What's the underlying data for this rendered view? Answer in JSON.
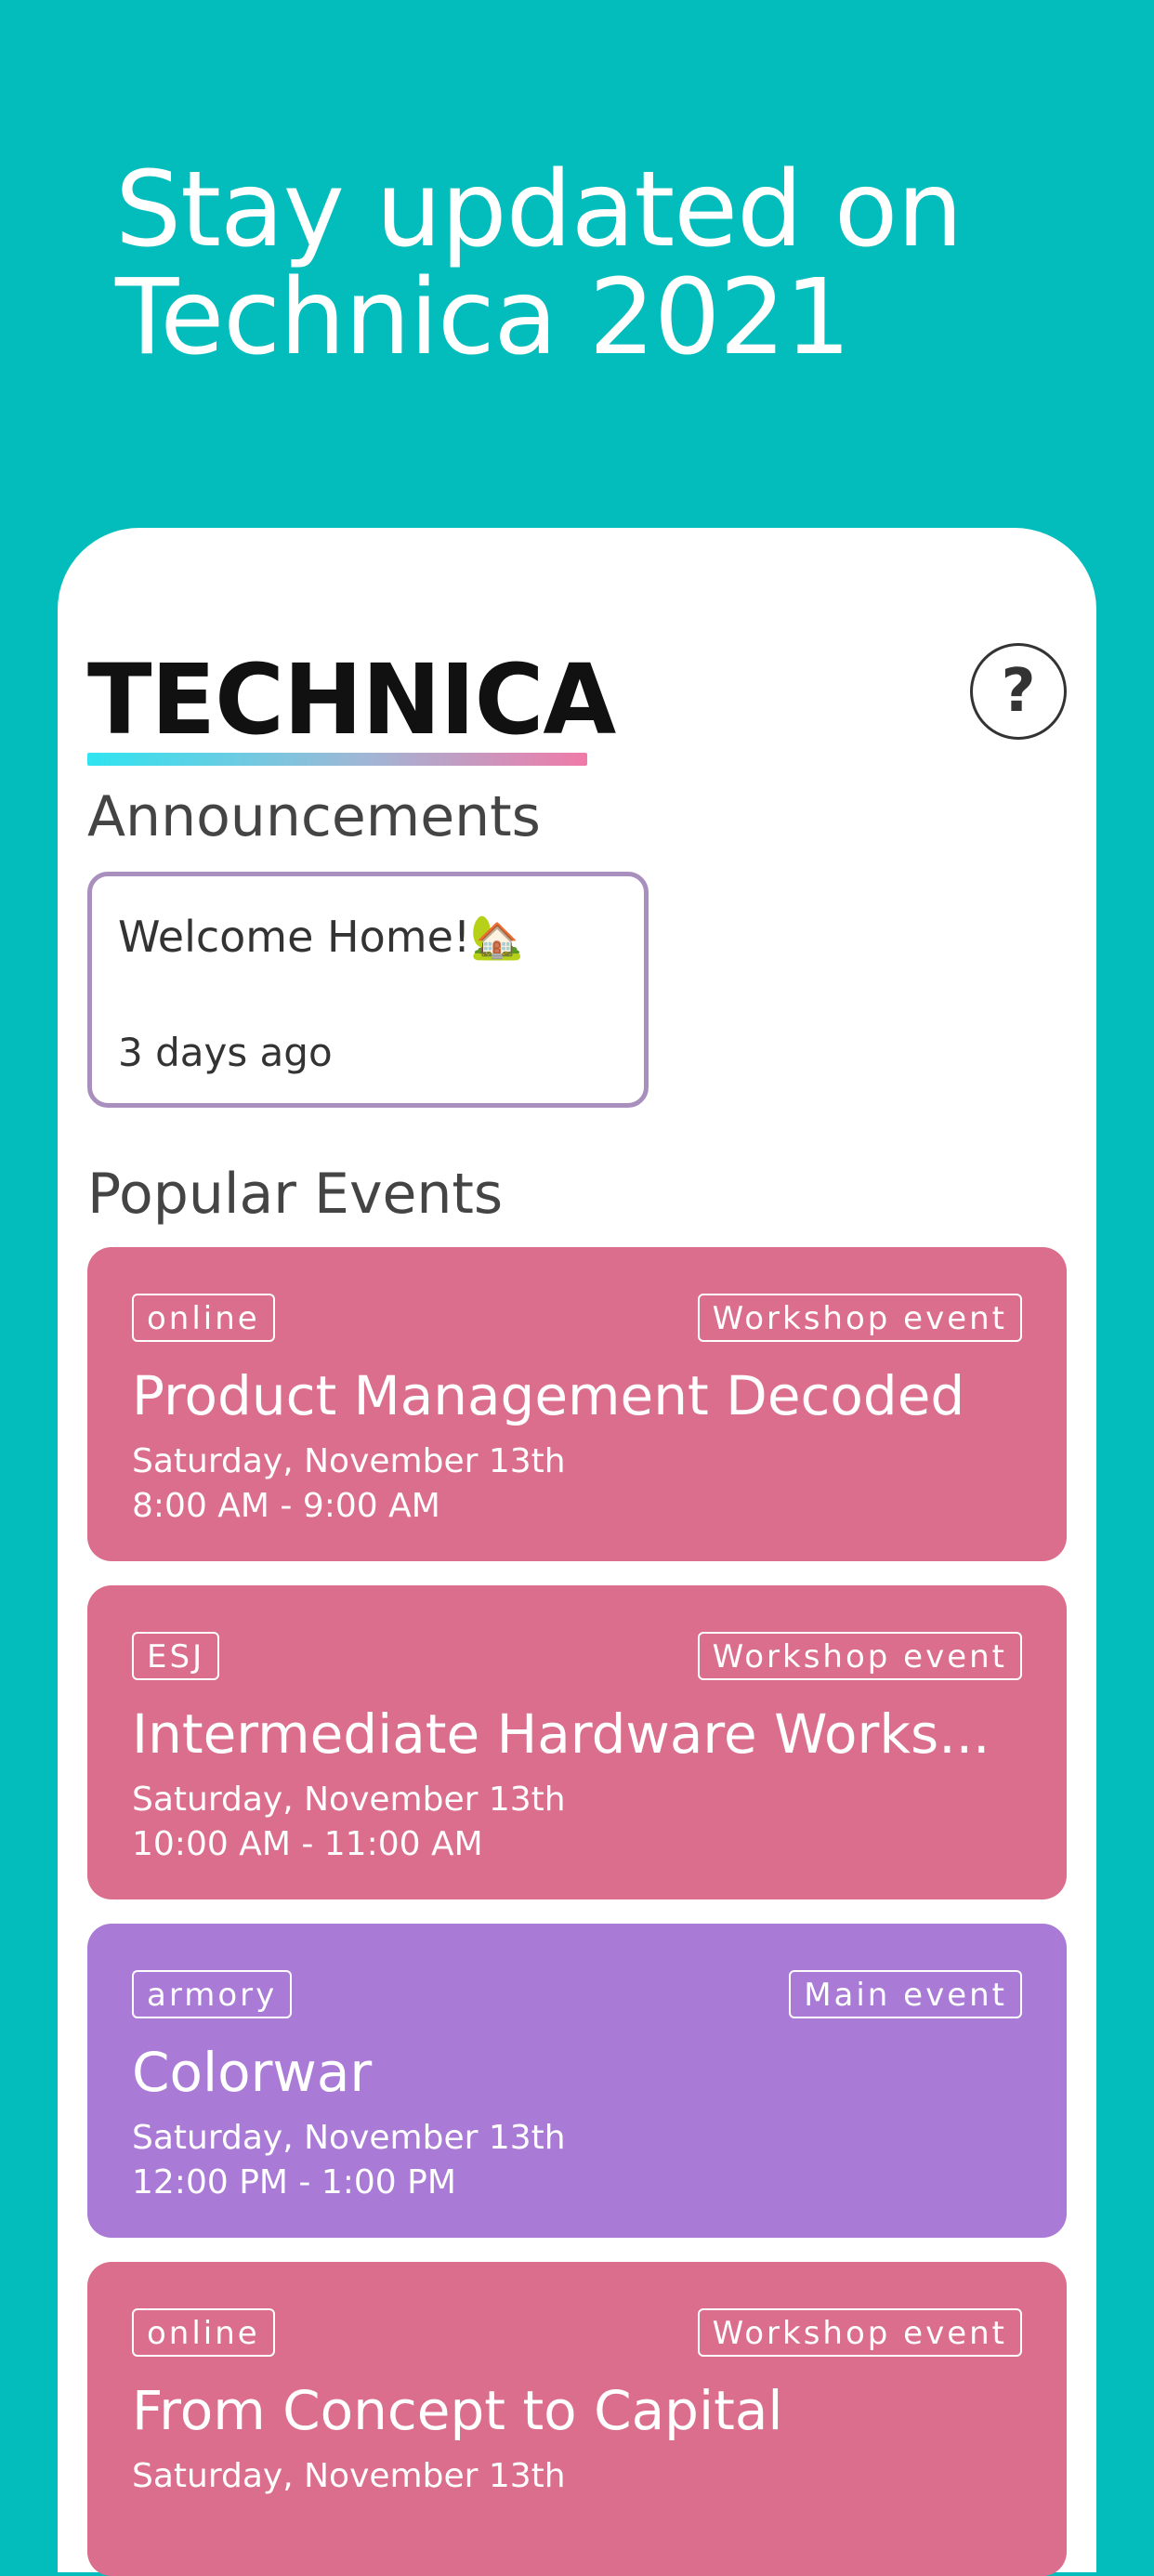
{
  "headline": {
    "line1": "Stay updated on",
    "line2": "Technica 2021"
  },
  "colors": {
    "background": "#03BCBC",
    "workshop_card": "#DB6E8C",
    "main_card": "#A97AD6",
    "announcement_border": "#A98FBE"
  },
  "app": {
    "brand": "TECHNICA",
    "help_label": "?",
    "announcements_title": "Announcements",
    "announcements": [
      {
        "title": "Welcome Home!🏡",
        "time": "3 days ago"
      }
    ],
    "popular_title": "Popular Events",
    "events": [
      {
        "location": "online",
        "type": "Workshop event",
        "title": "Product Management Decoded",
        "date": "Saturday, November 13th",
        "time": "8:00 AM - 9:00 AM"
      },
      {
        "location": "ESJ",
        "type": "Workshop event",
        "title": "Intermediate Hardware Works...",
        "date": "Saturday, November 13th",
        "time": "10:00 AM - 11:00 AM"
      },
      {
        "location": "armory",
        "type": "Main event",
        "title": "Colorwar",
        "date": "Saturday, November 13th",
        "time": "12:00 PM - 1:00 PM"
      },
      {
        "location": "online",
        "type": "Workshop event",
        "title": "From Concept to Capital",
        "date": "Saturday, November 13th",
        "time": ""
      }
    ]
  }
}
